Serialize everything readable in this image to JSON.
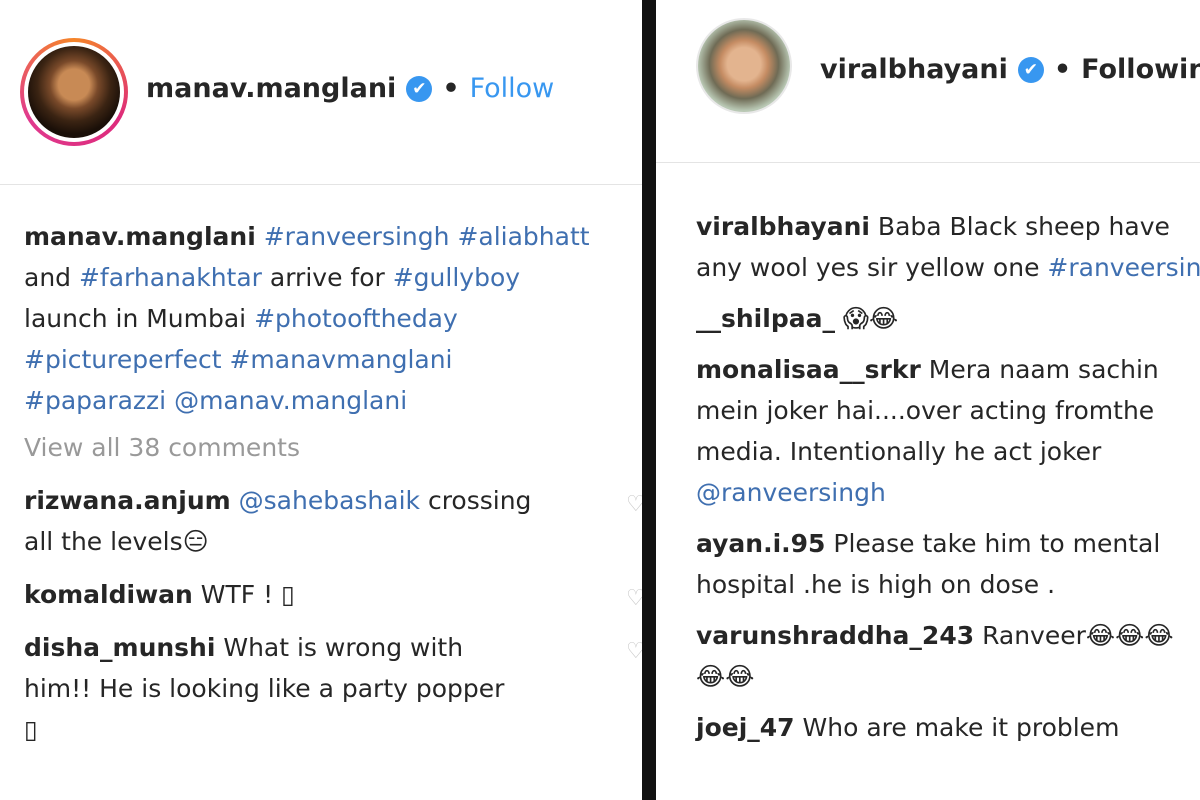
{
  "left_post": {
    "username": "manav.manglani",
    "verified_icon": "✔",
    "dot": "•",
    "follow_label": "Follow",
    "caption_lines": [
      [
        {
          "t": "manav.manglani",
          "k": "u"
        },
        {
          "t": " "
        },
        {
          "t": "#ranveersingh",
          "k": "tag"
        },
        {
          "t": " "
        },
        {
          "t": "#aliabhatt",
          "k": "tag"
        }
      ],
      [
        {
          "t": "and "
        },
        {
          "t": "#farhanakhtar",
          "k": "tag"
        },
        {
          "t": " arrive for "
        },
        {
          "t": "#gullyboy",
          "k": "tag"
        }
      ],
      [
        {
          "t": "launch in Mumbai "
        },
        {
          "t": "#photooftheday",
          "k": "tag"
        }
      ],
      [
        {
          "t": "#pictureperfect",
          "k": "tag"
        },
        {
          "t": " "
        },
        {
          "t": "#manavmanglani",
          "k": "tag"
        }
      ],
      [
        {
          "t": "#paparazzi",
          "k": "tag"
        },
        {
          "t": " "
        },
        {
          "t": "@manav.manglani",
          "k": "tag"
        }
      ]
    ],
    "view_all": "View all 38 comments",
    "comments": [
      {
        "lines": [
          [
            {
              "t": "rizwana.anjum",
              "k": "u"
            },
            {
              "t": " "
            },
            {
              "t": "@sahebashaik",
              "k": "tag"
            },
            {
              "t": " crossing"
            }
          ],
          [
            {
              "t": "all the levels😑"
            }
          ]
        ]
      },
      {
        "lines": [
          [
            {
              "t": "komaldiwan",
              "k": "u"
            },
            {
              "t": " WTF ! ▯"
            }
          ]
        ]
      },
      {
        "lines": [
          [
            {
              "t": "disha_munshi",
              "k": "u"
            },
            {
              "t": " What is wrong with"
            }
          ],
          [
            {
              "t": "him!! He is looking like a party popper"
            }
          ],
          [
            {
              "t": "▯"
            }
          ]
        ]
      }
    ]
  },
  "right_post": {
    "username": "viralbhayani",
    "verified_icon": "✔",
    "dot": "•",
    "follow_label": "Following",
    "caption_lines": [
      [
        {
          "t": "viralbhayani",
          "k": "u"
        },
        {
          "t": " Baba Black sheep have"
        }
      ],
      [
        {
          "t": "any wool yes sir yellow one "
        },
        {
          "t": "#ranveersingh",
          "k": "tag"
        }
      ]
    ],
    "comments": [
      {
        "lines": [
          [
            {
              "t": "__shilpaa_",
              "k": "u"
            },
            {
              "t": " 😱😂"
            }
          ]
        ]
      },
      {
        "lines": [
          [
            {
              "t": "monalisaa__srkr",
              "k": "u"
            },
            {
              "t": " Mera naam sachin"
            }
          ],
          [
            {
              "t": "mein joker hai....over acting fromthe"
            }
          ],
          [
            {
              "t": "media. Intentionally he act joker"
            }
          ],
          [
            {
              "t": "@ranveersingh",
              "k": "tag"
            }
          ]
        ]
      },
      {
        "lines": [
          [
            {
              "t": "ayan.i.95",
              "k": "u"
            },
            {
              "t": " Please take him to mental"
            }
          ],
          [
            {
              "t": "hospital .he is high on dose ."
            }
          ]
        ]
      },
      {
        "lines": [
          [
            {
              "t": "varunshraddha_243",
              "k": "u"
            },
            {
              "t": " Ranveer😂😂😂"
            }
          ],
          [
            {
              "t": "😂😂"
            }
          ]
        ]
      },
      {
        "lines": [
          [
            {
              "t": "joej_47",
              "k": "u"
            },
            {
              "t": " Who are make it problem"
            }
          ]
        ]
      }
    ]
  }
}
